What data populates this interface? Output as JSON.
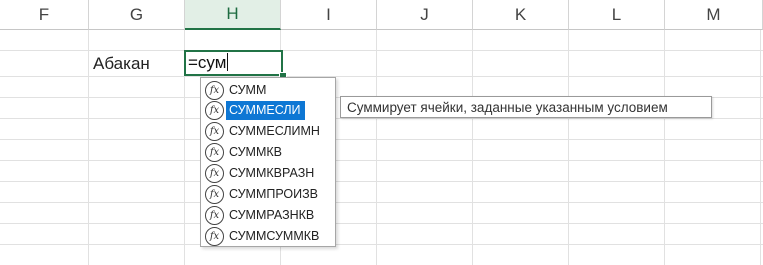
{
  "columns": [
    "F",
    "G",
    "H",
    "I",
    "J",
    "K",
    "L",
    "M"
  ],
  "active_column": "H",
  "cells": {
    "g_label": "Абакан"
  },
  "formula_input": "=сум",
  "autocomplete": {
    "items": [
      "СУММ",
      "СУММЕСЛИ",
      "СУММЕСЛИМН",
      "СУММКВ",
      "СУММКВРАЗН",
      "СУММПРОИЗВ",
      "СУММРАЗНКВ",
      "СУММСУММКВ"
    ],
    "selected": "СУММЕСЛИ",
    "icon_symbol": "fx"
  },
  "tooltip": "Суммирует ячейки, заданные указанным условием",
  "colors": {
    "accent": "#217346",
    "selection": "#0e77d4"
  }
}
